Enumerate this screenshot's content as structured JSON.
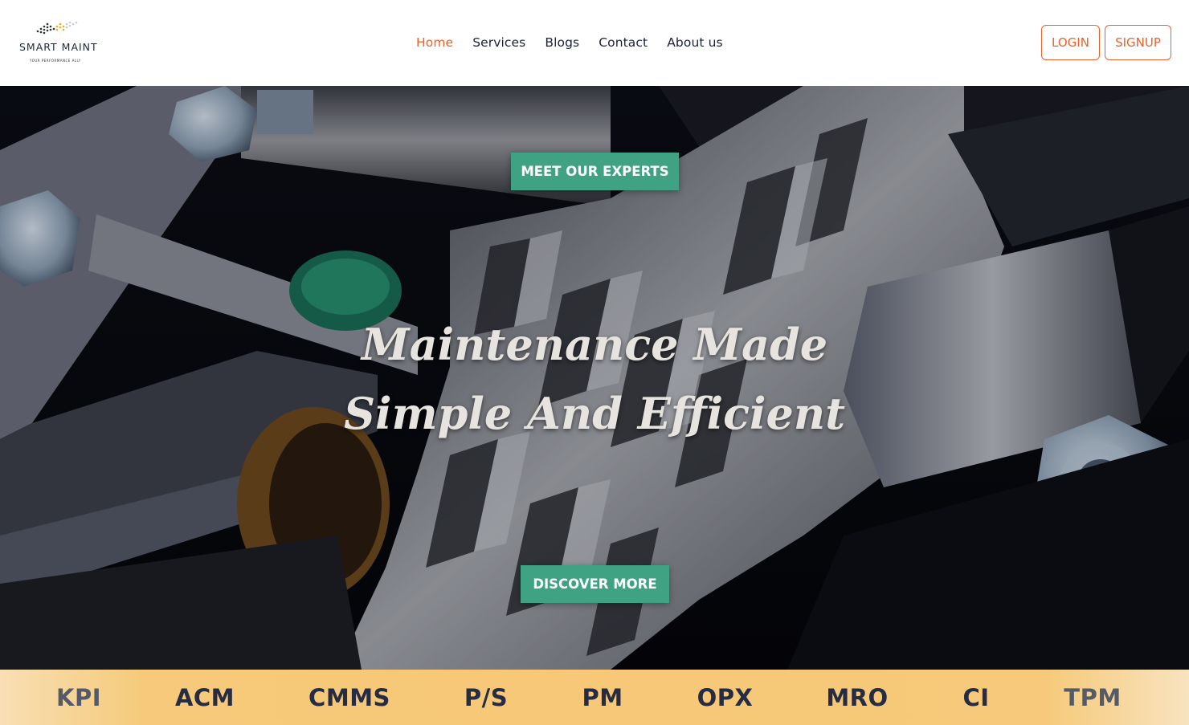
{
  "brand": {
    "name": "SMART MAINT",
    "tagline": "YOUR PERFORMANCE ALLY",
    "colors": {
      "accent": "#e8622a",
      "cta": "#3fa283",
      "nav_text": "#1b2239",
      "ticker_bg": "#f6c877"
    }
  },
  "nav": {
    "items": [
      {
        "label": "Home",
        "active": true
      },
      {
        "label": "Services",
        "active": false
      },
      {
        "label": "Blogs",
        "active": false
      },
      {
        "label": "Contact",
        "active": false
      },
      {
        "label": "About us",
        "active": false
      }
    ]
  },
  "auth": {
    "login_label": "LOGIN",
    "signup_label": "SIGNUP"
  },
  "hero": {
    "top_button_label": "MEET OUR EXPERTS",
    "title_line1": "Maintenance Made",
    "title_line2": "Simple And Efficient",
    "bottom_button_label": "DISCOVER MORE",
    "background": "gears-machinery-photo"
  },
  "ticker": {
    "items": [
      "KPI",
      "ACM",
      "CMMS",
      "P/S",
      "PM",
      "OPX",
      "MRO",
      "CI",
      "TPM"
    ]
  }
}
